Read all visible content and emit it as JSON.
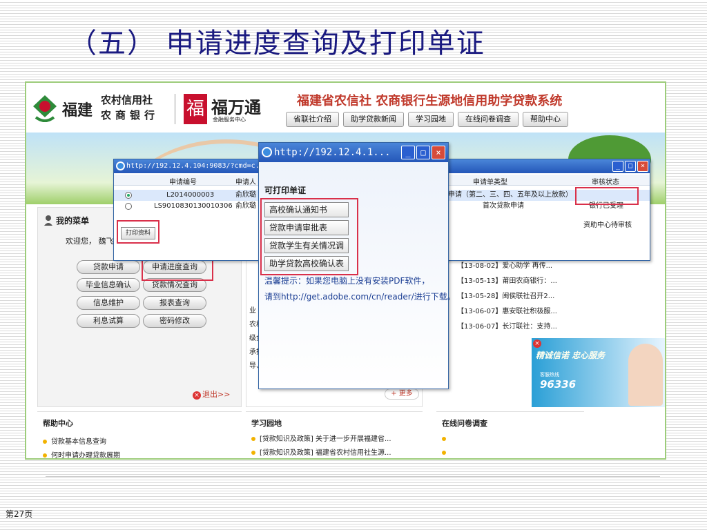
{
  "slide": {
    "title": "（五） 申请进度查询及打印单证",
    "page_label": "第27页"
  },
  "header": {
    "brand_fujian": "福建",
    "brand_bank_line1": "农村信用社",
    "brand_bank_line2": "农商银行",
    "brand_fwt_mark": "福",
    "brand_fwt": "福万通",
    "brand_fwt_sub": "金融服务中心",
    "system_title": "福建省农信社 农商银行生源地信用助学贷款系统",
    "nav": [
      "省联社介绍",
      "助学贷款新闻",
      "学习园地",
      "在线问卷调查",
      "帮助中心"
    ]
  },
  "menu": {
    "title": "我的菜单",
    "welcome": "欢迎您， 魏飞",
    "buttons": [
      "贷款申请",
      "申请进度查询",
      "毕业信息确认",
      "贷款情况查询",
      "信息维护",
      "报表查询",
      "利息试算",
      "密码修改"
    ],
    "logout": "退出>>"
  },
  "middle": {
    "intro_lines": [
      "业",
      "农村",
      "级金",
      "承担",
      "导、"
    ],
    "more": "+ 更多"
  },
  "news": {
    "items": [
      "【13-08-02】爱心助学 再传...",
      "【13-05-13】莆田农商银行：...",
      "【13-05-28】闽侯联社召开2...",
      "【13-06-07】惠安联社积极服...",
      "【13-06-07】长汀联社：支持..."
    ]
  },
  "ad": {
    "slogan": "精诚信诺 忠心服务",
    "phone_label": "客服热线",
    "phone": "96336"
  },
  "bottom": {
    "help_title": "帮助中心",
    "help_items": [
      "贷款基本信息查询",
      "何时申请办理贷款展期"
    ],
    "study_title": "学习园地",
    "study_items": [
      "[贷款知识及政策] 关于进一步开展福建省...",
      "[贷款知识及政策] 福建省农村信用社生源..."
    ],
    "survey_title": "在线问卷调查"
  },
  "table_window": {
    "title": "http://192.12.4.104:9083/?cmd=c... -FMC0009 - 申请进度查询 - Windows Int...",
    "headers": [
      "申请编号",
      "申请人",
      "申请单类型",
      "审核状态"
    ],
    "rows": [
      {
        "id": "L2014000003",
        "applicant": "俞欣璐",
        "type": "申请（第二、三、四、五年及以上放款）",
        "status": "资助中心待审核",
        "selected": true
      },
      {
        "id": "LS9010830130010306",
        "applicant": "俞欣璐",
        "type": "首次贷款申请",
        "status": "银行已受理",
        "selected": false
      }
    ],
    "print_button": "打印资料"
  },
  "popup": {
    "title": "http://192.12.4.1...",
    "heading": "可打印单证",
    "items": [
      "高校确认通知书",
      "贷款申请审批表",
      "贷款学生有关情况调",
      "助学贷款高校确认表"
    ],
    "tip": "温馨提示：如果您电脑上没有安装PDF软件，",
    "link": "请到http://get.adobe.com/cn/reader/进行下载。"
  },
  "colors": {
    "title": "#1a1a80",
    "system_title": "#c0392b",
    "highlight": "#d9304a",
    "frame_border": "#9ccc7a",
    "titlebar": "#2456b8"
  }
}
